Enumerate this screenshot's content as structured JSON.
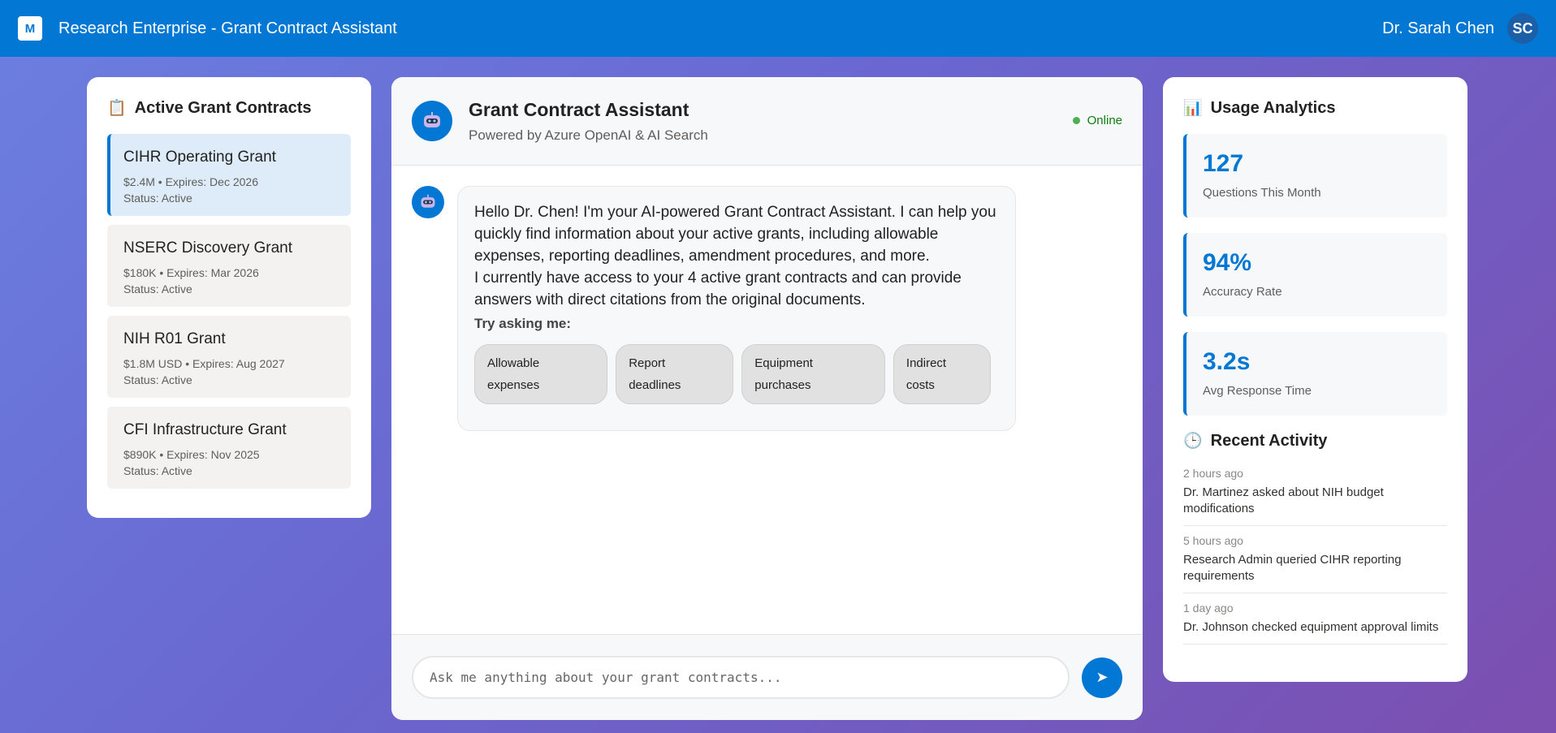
{
  "header": {
    "logo_letter": "M",
    "app_title": "Research Enterprise - Grant Contract Assistant",
    "user_name": "Dr. Sarah Chen",
    "user_initials": "SC"
  },
  "grants_panel": {
    "icon": "clipboard-icon",
    "title": "Active Grant Contracts",
    "items": [
      {
        "name": "CIHR Operating Grant",
        "meta": "$2.4M • Expires: Dec 2026",
        "status": "Status: Active",
        "selected": true
      },
      {
        "name": "NSERC Discovery Grant",
        "meta": "$180K • Expires: Mar 2026",
        "status": "Status: Active",
        "selected": false
      },
      {
        "name": "NIH R01 Grant",
        "meta": "$1.8M USD • Expires: Aug 2027",
        "status": "Status: Active",
        "selected": false
      },
      {
        "name": "CFI Infrastructure Grant",
        "meta": "$890K • Expires: Nov 2025",
        "status": "Status: Active",
        "selected": false
      }
    ]
  },
  "chat": {
    "title": "Grant Contract Assistant",
    "subtitle": "Powered by Azure OpenAI & AI Search",
    "status": "Online",
    "status_color": "#107c10",
    "messages": [
      {
        "sender": "assistant",
        "paragraph1": "Hello Dr. Chen! I'm your AI-powered Grant Contract Assistant. I can help you quickly find information about your active grants, including allowable expenses, reporting deadlines, amendment procedures, and more.",
        "paragraph2": "I currently have access to your 4 active grant contracts and can provide answers with direct citations from the original documents.",
        "try_label": "Try asking me:",
        "suggestions": [
          "Allowable expenses",
          "Report deadlines",
          "Equipment purchases",
          "Indirect costs"
        ]
      }
    ],
    "input_placeholder": "Ask me anything about your grant contracts...",
    "input_value": "",
    "send_icon": "send-arrow-icon"
  },
  "analytics": {
    "icon": "bar-chart-icon",
    "title": "Usage Analytics",
    "stats": [
      {
        "value": "127",
        "label": "Questions This Month"
      },
      {
        "value": "94%",
        "label": "Accuracy Rate"
      },
      {
        "value": "3.2s",
        "label": "Avg Response Time"
      }
    ],
    "recent_icon": "clock-icon",
    "recent_title": "Recent Activity",
    "activity": [
      {
        "time": "2 hours ago",
        "text": "Dr. Martinez asked about NIH budget modifications"
      },
      {
        "time": "5 hours ago",
        "text": "Research Admin queried CIHR reporting requirements"
      },
      {
        "time": "1 day ago",
        "text": "Dr. Johnson checked equipment approval limits"
      }
    ]
  },
  "colors": {
    "accent": "#0278d4",
    "header_bg": "#0278d4",
    "online": "#4caf50"
  }
}
